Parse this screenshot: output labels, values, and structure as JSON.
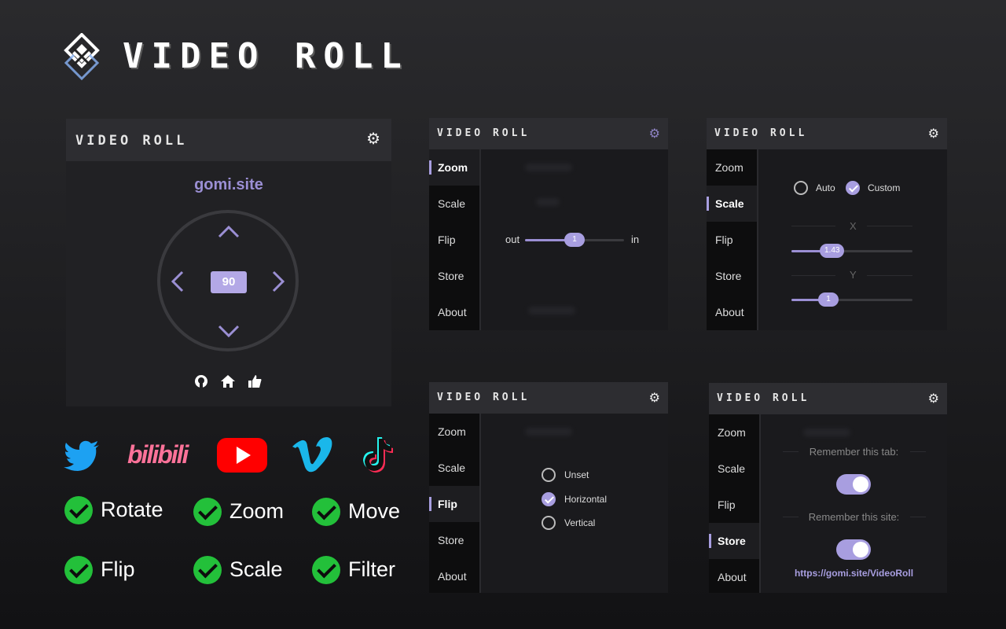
{
  "brand": {
    "title": "VIDEO ROLL"
  },
  "main": {
    "title": "VIDEO ROLL",
    "site": "gomi.site",
    "angle": "90",
    "footer_icons": [
      "github-icon",
      "home-icon",
      "thumbs-up-icon"
    ]
  },
  "zoom_panel": {
    "title": "VIDEO ROLL",
    "nav": [
      "Zoom",
      "Scale",
      "Flip",
      "Store",
      "About"
    ],
    "active": "Zoom",
    "out_label": "out",
    "in_label": "in",
    "value": "1"
  },
  "scale_panel": {
    "title": "VIDEO ROLL",
    "nav": [
      "Zoom",
      "Scale",
      "Flip",
      "Store",
      "About"
    ],
    "active": "Scale",
    "auto_label": "Auto",
    "custom_label": "Custom",
    "x_label": "X",
    "x_value": "1.43",
    "y_label": "Y",
    "y_value": "1"
  },
  "flip_panel": {
    "title": "VIDEO ROLL",
    "nav": [
      "Zoom",
      "Scale",
      "Flip",
      "Store",
      "About"
    ],
    "active": "Flip",
    "options": [
      "Unset",
      "Horizontal",
      "Vertical"
    ],
    "selected": "Horizontal"
  },
  "store_panel": {
    "title": "VIDEO ROLL",
    "nav": [
      "Zoom",
      "Scale",
      "Flip",
      "Store",
      "About"
    ],
    "active": "Store",
    "remember_tab": "Remember this tab:",
    "remember_site": "Remember this site:",
    "link": "https://gomi.site/VideoRoll"
  },
  "platforms": {
    "bilibili": "bilibili",
    "icons": [
      "twitter-icon",
      "bilibili-logo",
      "youtube-icon",
      "vimeo-icon",
      "tiktok-icon"
    ]
  },
  "features": [
    "Rotate",
    "Zoom",
    "Move",
    "Flip",
    "Scale",
    "Filter"
  ],
  "colors": {
    "accent": "#a89ee0",
    "check": "#23c03a",
    "youtube": "#ff0000",
    "twitter": "#1da1f2",
    "vimeo": "#1ab7ea",
    "bilibili": "#fb7299"
  }
}
